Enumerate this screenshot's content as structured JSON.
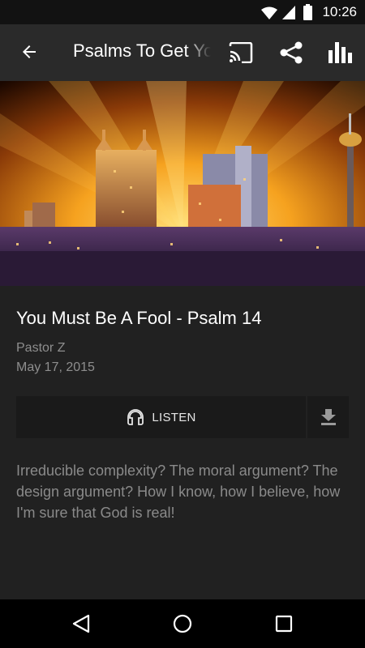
{
  "status_bar": {
    "time": "10:26"
  },
  "app_bar": {
    "title": "Psalms To Get You Through"
  },
  "sermon": {
    "title": "You Must Be A Fool - Psalm 14",
    "speaker": "Pastor Z",
    "date": "May 17, 2015",
    "listen_label": "LISTEN",
    "description": "Irreducible complexity? The moral argument? The design argument? How I know, how I believe, how I'm sure that God is real!"
  },
  "colors": {
    "background": "#212121",
    "app_bar": "#2a2a2a",
    "secondary_text": "#8e8e8e",
    "button_bg": "#1a1a1a"
  },
  "icons": [
    "wifi-icon",
    "signal-icon",
    "battery-icon",
    "back-arrow-icon",
    "cast-icon",
    "share-icon",
    "stats-icon",
    "headphones-icon",
    "download-icon",
    "nav-back-icon",
    "nav-home-icon",
    "nav-recents-icon"
  ]
}
